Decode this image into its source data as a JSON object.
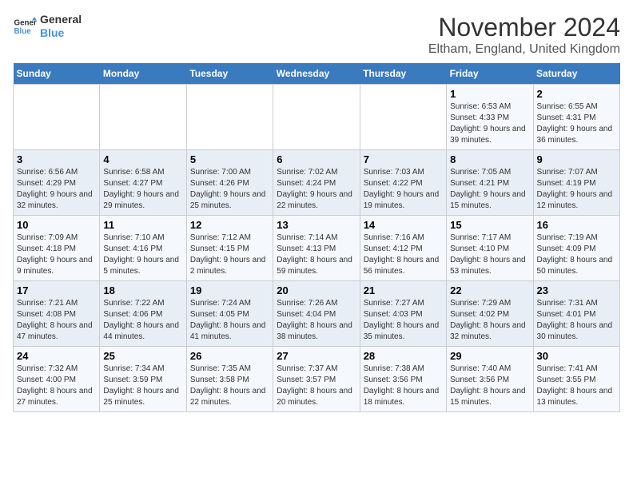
{
  "logo": {
    "line1": "General",
    "line2": "Blue"
  },
  "title": "November 2024",
  "subtitle": "Eltham, England, United Kingdom",
  "days_of_week": [
    "Sunday",
    "Monday",
    "Tuesday",
    "Wednesday",
    "Thursday",
    "Friday",
    "Saturday"
  ],
  "weeks": [
    [
      {
        "day": "",
        "info": ""
      },
      {
        "day": "",
        "info": ""
      },
      {
        "day": "",
        "info": ""
      },
      {
        "day": "",
        "info": ""
      },
      {
        "day": "",
        "info": ""
      },
      {
        "day": "1",
        "info": "Sunrise: 6:53 AM\nSunset: 4:33 PM\nDaylight: 9 hours and 39 minutes."
      },
      {
        "day": "2",
        "info": "Sunrise: 6:55 AM\nSunset: 4:31 PM\nDaylight: 9 hours and 36 minutes."
      }
    ],
    [
      {
        "day": "3",
        "info": "Sunrise: 6:56 AM\nSunset: 4:29 PM\nDaylight: 9 hours and 32 minutes."
      },
      {
        "day": "4",
        "info": "Sunrise: 6:58 AM\nSunset: 4:27 PM\nDaylight: 9 hours and 29 minutes."
      },
      {
        "day": "5",
        "info": "Sunrise: 7:00 AM\nSunset: 4:26 PM\nDaylight: 9 hours and 25 minutes."
      },
      {
        "day": "6",
        "info": "Sunrise: 7:02 AM\nSunset: 4:24 PM\nDaylight: 9 hours and 22 minutes."
      },
      {
        "day": "7",
        "info": "Sunrise: 7:03 AM\nSunset: 4:22 PM\nDaylight: 9 hours and 19 minutes."
      },
      {
        "day": "8",
        "info": "Sunrise: 7:05 AM\nSunset: 4:21 PM\nDaylight: 9 hours and 15 minutes."
      },
      {
        "day": "9",
        "info": "Sunrise: 7:07 AM\nSunset: 4:19 PM\nDaylight: 9 hours and 12 minutes."
      }
    ],
    [
      {
        "day": "10",
        "info": "Sunrise: 7:09 AM\nSunset: 4:18 PM\nDaylight: 9 hours and 9 minutes."
      },
      {
        "day": "11",
        "info": "Sunrise: 7:10 AM\nSunset: 4:16 PM\nDaylight: 9 hours and 5 minutes."
      },
      {
        "day": "12",
        "info": "Sunrise: 7:12 AM\nSunset: 4:15 PM\nDaylight: 9 hours and 2 minutes."
      },
      {
        "day": "13",
        "info": "Sunrise: 7:14 AM\nSunset: 4:13 PM\nDaylight: 8 hours and 59 minutes."
      },
      {
        "day": "14",
        "info": "Sunrise: 7:16 AM\nSunset: 4:12 PM\nDaylight: 8 hours and 56 minutes."
      },
      {
        "day": "15",
        "info": "Sunrise: 7:17 AM\nSunset: 4:10 PM\nDaylight: 8 hours and 53 minutes."
      },
      {
        "day": "16",
        "info": "Sunrise: 7:19 AM\nSunset: 4:09 PM\nDaylight: 8 hours and 50 minutes."
      }
    ],
    [
      {
        "day": "17",
        "info": "Sunrise: 7:21 AM\nSunset: 4:08 PM\nDaylight: 8 hours and 47 minutes."
      },
      {
        "day": "18",
        "info": "Sunrise: 7:22 AM\nSunset: 4:06 PM\nDaylight: 8 hours and 44 minutes."
      },
      {
        "day": "19",
        "info": "Sunrise: 7:24 AM\nSunset: 4:05 PM\nDaylight: 8 hours and 41 minutes."
      },
      {
        "day": "20",
        "info": "Sunrise: 7:26 AM\nSunset: 4:04 PM\nDaylight: 8 hours and 38 minutes."
      },
      {
        "day": "21",
        "info": "Sunrise: 7:27 AM\nSunset: 4:03 PM\nDaylight: 8 hours and 35 minutes."
      },
      {
        "day": "22",
        "info": "Sunrise: 7:29 AM\nSunset: 4:02 PM\nDaylight: 8 hours and 32 minutes."
      },
      {
        "day": "23",
        "info": "Sunrise: 7:31 AM\nSunset: 4:01 PM\nDaylight: 8 hours and 30 minutes."
      }
    ],
    [
      {
        "day": "24",
        "info": "Sunrise: 7:32 AM\nSunset: 4:00 PM\nDaylight: 8 hours and 27 minutes."
      },
      {
        "day": "25",
        "info": "Sunrise: 7:34 AM\nSunset: 3:59 PM\nDaylight: 8 hours and 25 minutes."
      },
      {
        "day": "26",
        "info": "Sunrise: 7:35 AM\nSunset: 3:58 PM\nDaylight: 8 hours and 22 minutes."
      },
      {
        "day": "27",
        "info": "Sunrise: 7:37 AM\nSunset: 3:57 PM\nDaylight: 8 hours and 20 minutes."
      },
      {
        "day": "28",
        "info": "Sunrise: 7:38 AM\nSunset: 3:56 PM\nDaylight: 8 hours and 18 minutes."
      },
      {
        "day": "29",
        "info": "Sunrise: 7:40 AM\nSunset: 3:56 PM\nDaylight: 8 hours and 15 minutes."
      },
      {
        "day": "30",
        "info": "Sunrise: 7:41 AM\nSunset: 3:55 PM\nDaylight: 8 hours and 13 minutes."
      }
    ]
  ]
}
